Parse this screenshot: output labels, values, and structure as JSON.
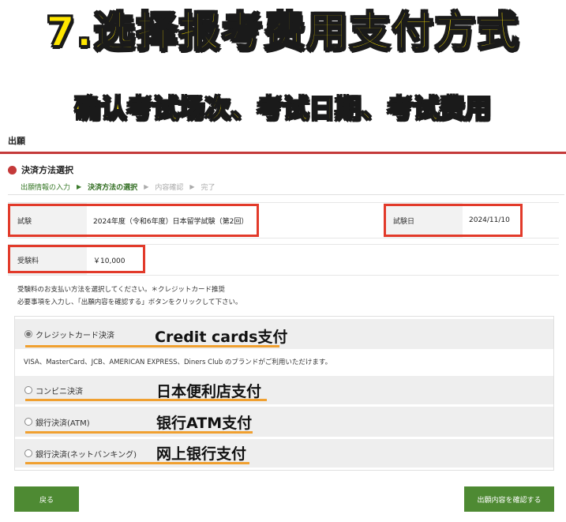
{
  "banner": {
    "title": "7.选择报考费用支付方式",
    "subtitle": "确认考试场次、考试日期、考试费用"
  },
  "page": {
    "heading": "出願",
    "section_title": "決済方法選択"
  },
  "steps": [
    {
      "label": "出願情報の入力",
      "state": "done"
    },
    {
      "label": "決済方法の選択",
      "state": "current"
    },
    {
      "label": "内容確認",
      "state": "todo"
    },
    {
      "label": "完了",
      "state": "todo"
    }
  ],
  "exam": {
    "exam_label": "試験",
    "exam_value": "2024年度（令和6年度）日本留学試験（第2回）",
    "date_label": "試験日",
    "date_value": "2024/11/10",
    "fee_label": "受験料",
    "fee_value": "￥10,000"
  },
  "notes": {
    "line1": "受験料のお支払い方法を選択してください。＊クレジットカード推奨",
    "line2": "必要事項を入力し、「出願内容を確認する」ボタンをクリックして下さい。"
  },
  "payment": {
    "options": [
      {
        "label": "クレジットカード決済",
        "overlay": "Credit cards支付",
        "selected": true
      },
      {
        "label": "コンビニ決済",
        "overlay": "日本便利店支付",
        "selected": false
      },
      {
        "label": "銀行決済(ATM)",
        "overlay": "银行ATM支付",
        "selected": false
      },
      {
        "label": "銀行決済(ネットバンキング)",
        "overlay": "网上银行支付",
        "selected": false
      }
    ],
    "card_brands": "VISA、MasterCard、JCB、AMERICAN EXPRESS、Diners Club のブランドがご利用いただけます。"
  },
  "buttons": {
    "back": "戻る",
    "confirm": "出願内容を確認する"
  },
  "colors": {
    "accent_red": "#c43a3a",
    "highlight_red": "#e23a2a",
    "button_green": "#4e8a33",
    "underline_orange": "#f0a030",
    "banner_yellow": "#ffe600"
  }
}
